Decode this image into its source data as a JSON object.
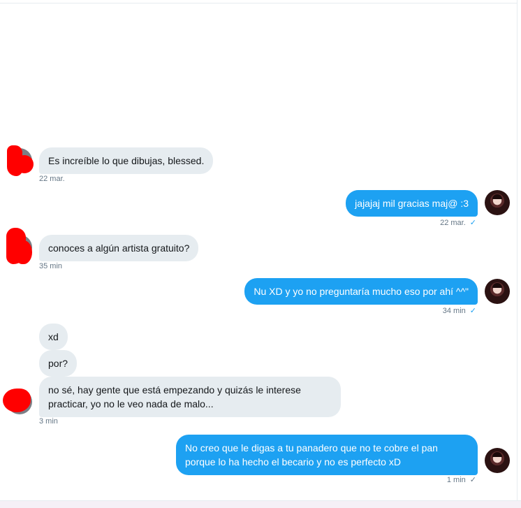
{
  "messages": [
    {
      "side": "in",
      "text": "Es increíble lo que dibujas, blessed.",
      "time": "22 mar."
    },
    {
      "side": "out",
      "text": "jajajaj mil gracias maj@ :3",
      "time": "22 mar."
    },
    {
      "side": "in",
      "text": "conoces a algún artista gratuito?",
      "time": "35 min"
    },
    {
      "side": "out",
      "text": "Nu XD y yo no preguntaría mucho eso por ahí ^^\"",
      "time": "34 min"
    },
    {
      "side": "in",
      "text": "xd"
    },
    {
      "side": "in",
      "text": "por?"
    },
    {
      "side": "in",
      "text": "no sé, hay gente que está empezando y quizás le interese practicar, yo no le veo nada de malo...",
      "time": "3 min"
    },
    {
      "side": "out",
      "text": "No creo que le digas a tu panadero que no te cobre el pan porque lo ha hecho el becario y no es perfecto xD",
      "time": "1 min"
    }
  ],
  "icons": {
    "sent": "check-icon",
    "seen": "check-icon"
  },
  "colors": {
    "outgoing_bubble": "#1da1f2",
    "incoming_bubble": "#e6ecf0",
    "meta_text": "#657786"
  }
}
